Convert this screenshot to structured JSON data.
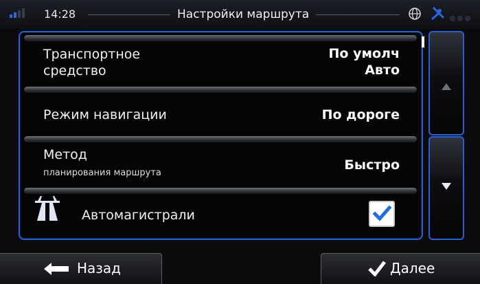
{
  "status": {
    "time": "14:28",
    "title": "Настройки маршрута"
  },
  "settings": [
    {
      "label_line1": "Транспортное",
      "label_line2": "средство",
      "value_line1": "По умолч",
      "value_line2": "Авто"
    },
    {
      "label": "Режим навигации",
      "value": "По дороге"
    },
    {
      "label_line1": "Метод",
      "sublabel": "планирования маршрута",
      "value": "Быстро"
    },
    {
      "label": "Автомагистрали",
      "checked": true
    }
  ],
  "buttons": {
    "back": "Назад",
    "next": "Далее"
  },
  "colors": {
    "accent": "#2a5fd1",
    "check": "#1f6fe0"
  },
  "icons": [
    "signal-strength-icon",
    "globe-icon",
    "satellite-icon",
    "highway-icon",
    "check-icon",
    "scroll-up-icon",
    "scroll-down-icon",
    "arrow-left-icon",
    "checkmark-icon"
  ]
}
